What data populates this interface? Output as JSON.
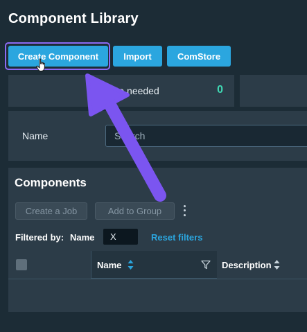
{
  "header": {
    "title": "Component Library"
  },
  "toolbar": {
    "create_label": "Create Component",
    "import_label": "Import",
    "comstore_label": "ComStore"
  },
  "stats": {
    "label": "Update needed",
    "value": "0"
  },
  "filter": {
    "name_label": "Name",
    "search_placeholder": "Search"
  },
  "components": {
    "title": "Components",
    "create_job_label": "Create a Job",
    "add_group_label": "Add to Group",
    "filtered_by_label": "Filtered by:",
    "filtered_field": "Name",
    "chip_value": "X",
    "reset_label": "Reset filters",
    "columns": {
      "name": "Name",
      "description": "Description"
    }
  },
  "colors": {
    "accent": "#2ba6df",
    "focus": "#8b6bf4",
    "stat_value": "#40d8b3",
    "annotation_arrow": "#7b55f0"
  }
}
